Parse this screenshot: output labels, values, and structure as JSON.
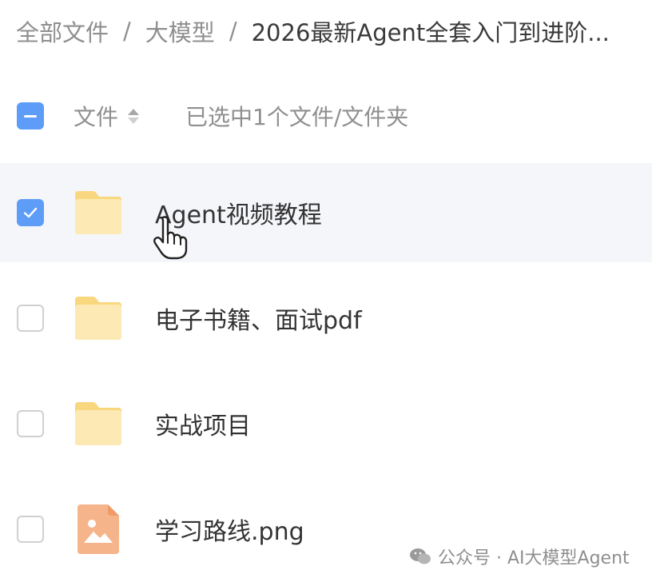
{
  "breadcrumb": {
    "items": [
      "全部文件",
      "大模型"
    ],
    "separator": "/",
    "current": "2026最新Agent全套入门到进阶..."
  },
  "header": {
    "select_all_state": "partial",
    "column_file_label": "文件",
    "sort_icon": "sort-icon",
    "selection_status": "已选中1个文件/文件夹"
  },
  "files": [
    {
      "name": "Agent视频教程",
      "type": "folder",
      "checked": true
    },
    {
      "name": "电子书籍、面试pdf",
      "type": "folder",
      "checked": false
    },
    {
      "name": "实战项目",
      "type": "folder",
      "checked": false
    },
    {
      "name": "学习路线.png",
      "type": "image",
      "checked": false
    }
  ],
  "cursor": {
    "icon": "hand-pointer-icon"
  },
  "watermark": {
    "text": "公众号 · AI大模型Agent",
    "icon": "wechat-icon"
  },
  "colors": {
    "accent": "#5d9df7",
    "folder": "#fbe3a0",
    "image_file": "#f4a978",
    "selected_row": "#f5f6fa",
    "muted_text": "#8f8f8f"
  }
}
